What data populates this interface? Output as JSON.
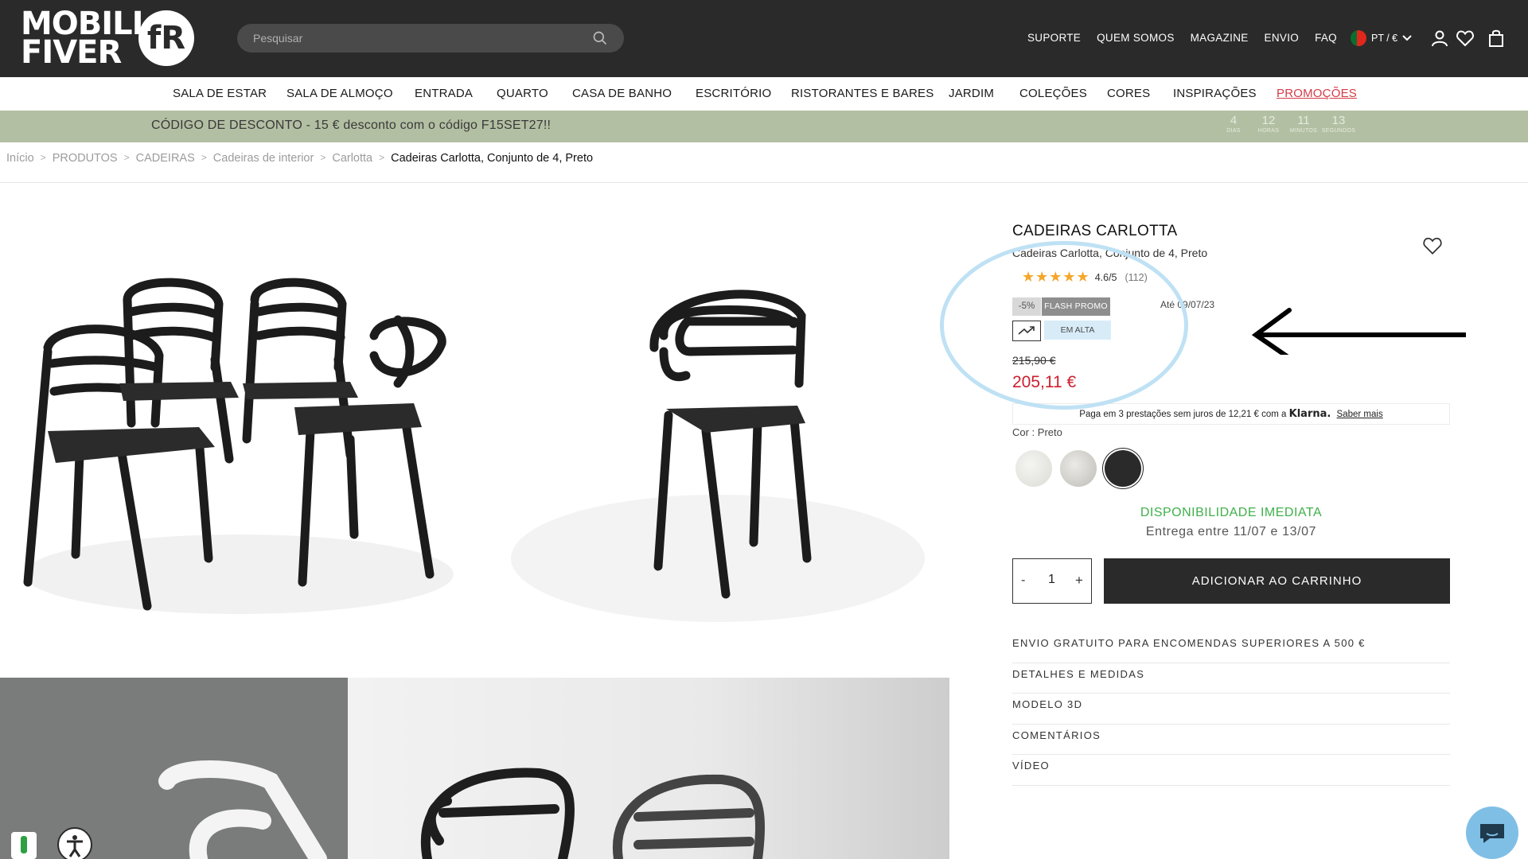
{
  "header": {
    "logo_text_line1": "MOBILI",
    "logo_text_line2": "FIVER",
    "logo_glyph": "fR",
    "search_placeholder": "Pesquisar",
    "top_links": [
      "SUPORTE",
      "QUEM SOMOS",
      "MAGAZINE",
      "ENVIO",
      "FAQ"
    ],
    "locale": "PT / €",
    "icons": [
      "search-icon",
      "user-icon",
      "heart-icon",
      "bag-icon",
      "chevron-down-icon"
    ]
  },
  "categories": [
    "SALA DE ESTAR",
    "SALA DE ALMOÇO",
    "ENTRADA",
    "QUARTO",
    "CASA DE BANHO",
    "ESCRITÓRIO",
    "RISTORANTES E BARES",
    "JARDIM",
    "COLEÇÕES",
    "CORES",
    "INSPIRAÇÕES",
    "PROMOÇÕES"
  ],
  "promo": {
    "text": "CÓDIGO DE DESCONTO - 15 € desconto com o código F15SET27!!",
    "countdown": [
      {
        "value": "4",
        "label": "DIAS"
      },
      {
        "value": "12",
        "label": "HORAS"
      },
      {
        "value": "11",
        "label": "MINUTOS"
      },
      {
        "value": "13",
        "label": "SEGUNDOS"
      }
    ]
  },
  "breadcrumb": [
    "Início",
    "PRODUTOS",
    "CADEIRAS",
    "Cadeiras de interior",
    "Carlotta",
    "Cadeiras Carlotta, Conjunto de 4, Preto"
  ],
  "product": {
    "title": "CADEIRAS CARLOTTA",
    "subtitle": "Cadeiras Carlotta, Conjunto de 4, Preto",
    "rating_stars": "★★★★★",
    "rating_value": 4.6,
    "rating_score": "4.6/5",
    "rating_count": "(112)",
    "discount_badge": "-5%",
    "flash_badge": "FLASH PROMO",
    "until_text": "Até 09/07/23",
    "trend_badge": "EM ALTA",
    "old_price": "215,90 €",
    "new_price": "205,11 €",
    "klarna_text": "Paga em 3 prestações sem juros de 12,21 € com a",
    "klarna_brand": "Klarna.",
    "klarna_link": "Saber mais",
    "color_label": "Cor : Preto",
    "swatches": [
      "#e9e9e6",
      "#cfcfcb",
      "#2a2a2a"
    ],
    "availability": "DISPONIBILIDADE IMEDIATA",
    "delivery": "Entrega entre 11/07 e 13/07",
    "qty_minus": "-",
    "qty_value": "1",
    "qty_plus": "+",
    "cart_button": "ADICIONAR AO CARRINHO",
    "info_items": [
      "ENVIO GRATUITO PARA ENCOMENDAS SUPERIORES A 500 €",
      "DETALHES E MEDIDAS",
      "MODELO 3D",
      "COMENTÁRIOS",
      "VÍDEO"
    ]
  },
  "colors": {
    "header_bg": "#2a2a2a",
    "promo_bg": "#b3bfa2",
    "price_red": "#cc1f2e",
    "availability_green": "#3fb04a",
    "annotation_blue": "#bfe1f4"
  }
}
